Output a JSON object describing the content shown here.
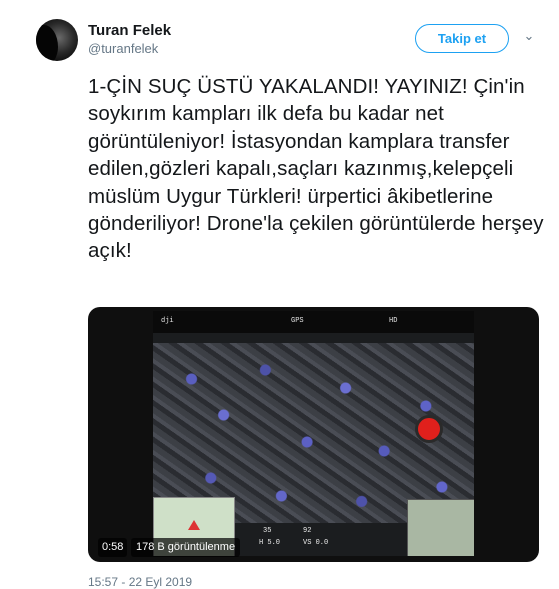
{
  "author": {
    "name": "Turan Felek",
    "handle": "@turanfelek"
  },
  "follow_button": {
    "label": "Takip et"
  },
  "tweet": {
    "text": "1-ÇİN SUÇ ÜSTÜ YAKALANDI! YAYINIZ! Çin'in soykırım kampları ilk defa bu kadar net görüntüleniyor! İstasyondan kamplara transfer edilen,gözleri kapalı,saçları kazınmış,kelepçeli müslüm Uygur Türkleri! ürpertici âkibetlerine gönderiliyor! Drone'la çekilen görüntülerde herşey açık!"
  },
  "video": {
    "duration": "0:58",
    "views": "178 B görüntülenme",
    "hud": {
      "brand": "dji",
      "gps": "GPS",
      "hd": "HD",
      "h_value": "35",
      "d_value": "92",
      "h_label": "H 5.0",
      "v_label": "VS 0.0"
    }
  },
  "timestamp": "15:57 - 22 Eyl 2019",
  "colors": {
    "accent": "#1da1f2",
    "text": "#14171a",
    "secondary": "#657786"
  }
}
